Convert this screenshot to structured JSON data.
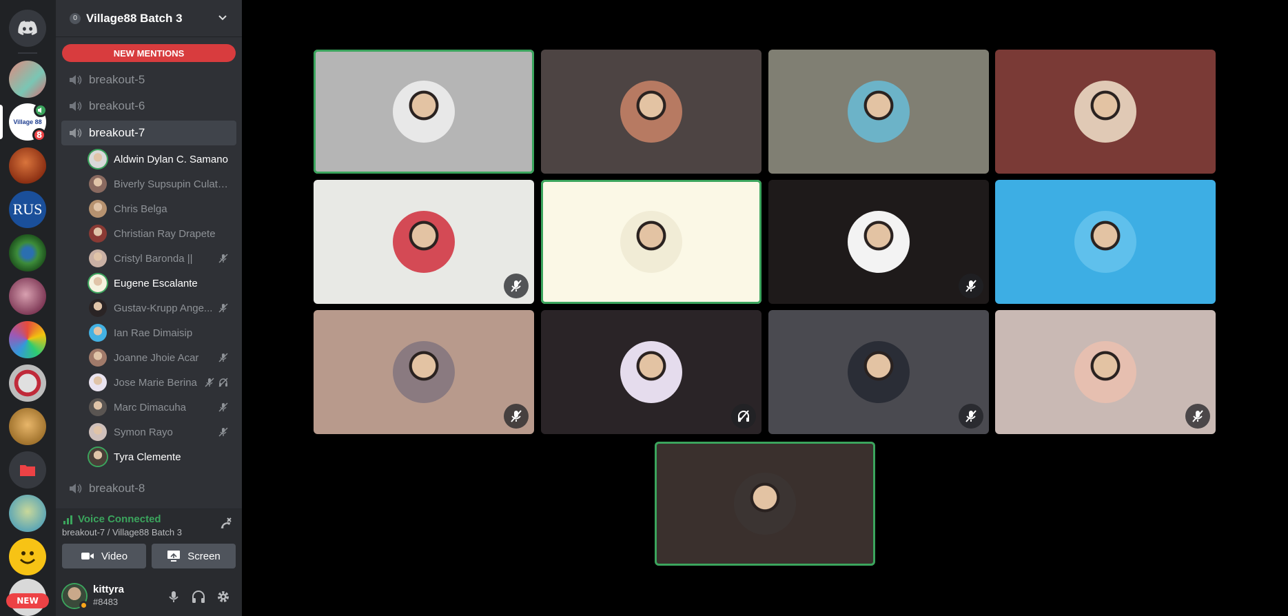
{
  "guild": {
    "name": "Village88 Batch 3",
    "badge": "0"
  },
  "rail": {
    "badge_count": "8",
    "new_label": "NEW",
    "active_server_label": "Village 88"
  },
  "banner": {
    "label": "NEW MENTIONS"
  },
  "channels": [
    {
      "label": "breakout-5"
    },
    {
      "label": "breakout-6"
    },
    {
      "label": "breakout-7"
    },
    {
      "label": "breakout-8"
    }
  ],
  "members": [
    {
      "name": "Aldwin Dylan C. Samano",
      "speaking": true,
      "bright": true,
      "muted": false,
      "deafened": false,
      "color": "#d9d9d9"
    },
    {
      "name": "Biverly Supsupin Culaton",
      "speaking": false,
      "bright": false,
      "muted": false,
      "deafened": false,
      "color": "#8a6a60"
    },
    {
      "name": "Chris Belga",
      "speaking": false,
      "bright": false,
      "muted": false,
      "deafened": false,
      "color": "#b69270"
    },
    {
      "name": "Christian Ray Drapete",
      "speaking": false,
      "bright": false,
      "muted": false,
      "deafened": false,
      "color": "#8a3a34"
    },
    {
      "name": "Cristyl Baronda ||",
      "speaking": false,
      "bright": false,
      "muted": true,
      "deafened": false,
      "color": "#c9b0a4"
    },
    {
      "name": "Eugene Escalante",
      "speaking": true,
      "bright": true,
      "muted": false,
      "deafened": false,
      "color": "#f5f2df"
    },
    {
      "name": "Gustav-Krupp Ange...",
      "speaking": false,
      "bright": false,
      "muted": true,
      "deafened": false,
      "color": "#2a2425"
    },
    {
      "name": "Ian Rae Dimaisip",
      "speaking": false,
      "bright": false,
      "muted": false,
      "deafened": false,
      "color": "#43b1e2"
    },
    {
      "name": "Joanne Jhoie Acar",
      "speaking": false,
      "bright": false,
      "muted": true,
      "deafened": false,
      "color": "#a07a6a"
    },
    {
      "name": "Jose Marie Berina",
      "speaking": false,
      "bright": false,
      "muted": true,
      "deafened": true,
      "color": "#e9e3ef"
    },
    {
      "name": "Marc Dimacuha",
      "speaking": false,
      "bright": false,
      "muted": true,
      "deafened": false,
      "color": "#5a5552"
    },
    {
      "name": "Symon Rayo",
      "speaking": false,
      "bright": false,
      "muted": true,
      "deafened": false,
      "color": "#cfc0bb"
    },
    {
      "name": "Tyra Clemente",
      "speaking": true,
      "bright": true,
      "muted": false,
      "deafened": false,
      "color": "#4a3f38"
    }
  ],
  "voice": {
    "status": "Voice Connected",
    "location": "breakout-7 / Village88 Batch 3",
    "video_label": "Video",
    "screen_label": "Screen"
  },
  "user": {
    "name": "kittyra",
    "tag": "#8483"
  },
  "tiles": [
    {
      "bg": "#b5b5b5",
      "avatar": "#e8e8e8",
      "speaking": true,
      "status": "none"
    },
    {
      "bg": "#4d4443",
      "avatar": "#b77a62",
      "speaking": false,
      "status": "none"
    },
    {
      "bg": "#807f73",
      "avatar": "#6cb3c8",
      "speaking": false,
      "status": "none"
    },
    {
      "bg": "#7a3a36",
      "avatar": "#e0c9b5",
      "speaking": false,
      "status": "none"
    },
    {
      "bg": "#e8e9e5",
      "avatar": "#d44a55",
      "speaking": false,
      "status": "muted"
    },
    {
      "bg": "#fbf8e6",
      "avatar": "#f1ecd6",
      "speaking": true,
      "status": "none"
    },
    {
      "bg": "#1e1a1a",
      "avatar": "#f3f3f3",
      "speaking": false,
      "status": "muted"
    },
    {
      "bg": "#3daee4",
      "avatar": "#5fc0ec",
      "speaking": false,
      "status": "none"
    },
    {
      "bg": "#b89a8c",
      "avatar": "#8a7a80",
      "speaking": false,
      "status": "muted"
    },
    {
      "bg": "#2a2427",
      "avatar": "#e5dced",
      "speaking": false,
      "status": "deafened"
    },
    {
      "bg": "#4a4a50",
      "avatar": "#2a2d36",
      "speaking": false,
      "status": "muted"
    },
    {
      "bg": "#c9b9b4",
      "avatar": "#e6bfb0",
      "speaking": false,
      "status": "muted"
    },
    {
      "bg": "#3a302d",
      "avatar": "#3b3432",
      "speaking": true,
      "status": "none"
    }
  ]
}
